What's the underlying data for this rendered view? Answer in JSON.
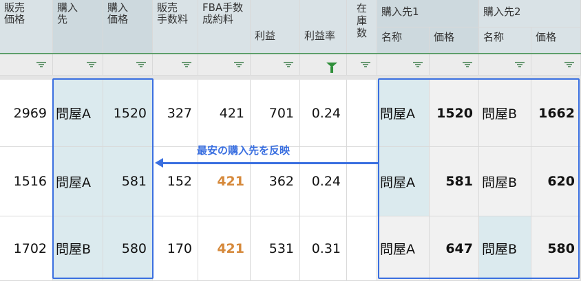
{
  "headers": {
    "sell_price": "販売\n価格",
    "supplier": "購入\n先",
    "buy_price": "購入\n価格",
    "sell_fee": "販売\n手数料",
    "fba_fee": "FBA手数\n成約料",
    "profit": "利益",
    "profit_rate": "利益率",
    "stock": "在\n庫\n数",
    "supplier1": "購入先1",
    "supplier2": "購入先2",
    "s1_name": "名称",
    "s1_price": "価格",
    "s2_name": "名称",
    "s2_price": "価格"
  },
  "rows": [
    {
      "sell_price": "2969",
      "supplier": "問屋A",
      "buy_price": "1520",
      "sell_fee": "327",
      "fba_fee": "421",
      "profit": "701",
      "profit_rate": "0.24",
      "stock": "",
      "s1_name": "問屋A",
      "s1_price": "1520",
      "s2_name": "問屋B",
      "s2_price": "1662"
    },
    {
      "sell_price": "1516",
      "supplier": "問屋A",
      "buy_price": "581",
      "sell_fee": "152",
      "fba_fee": "421",
      "profit": "362",
      "profit_rate": "0.24",
      "stock": "",
      "s1_name": "問屋A",
      "s1_price": "581",
      "s2_name": "問屋B",
      "s2_price": "620"
    },
    {
      "sell_price": "1702",
      "supplier": "問屋B",
      "buy_price": "580",
      "sell_fee": "170",
      "fba_fee": "421",
      "profit": "531",
      "profit_rate": "0.31",
      "stock": "",
      "s1_name": "問屋A",
      "s1_price": "647",
      "s2_name": "問屋B",
      "s2_price": "580"
    }
  ],
  "annotation": "最安の購入先を反映",
  "colors": {
    "header_bg": "#d9e2e6",
    "filter_bg": "#ececec",
    "highlight": "#dbeaee",
    "accent": "#3a6fe0",
    "orange": "#d6893b"
  },
  "icons": {
    "filter": "filter-icon",
    "filter_active": "filter-active-icon"
  }
}
